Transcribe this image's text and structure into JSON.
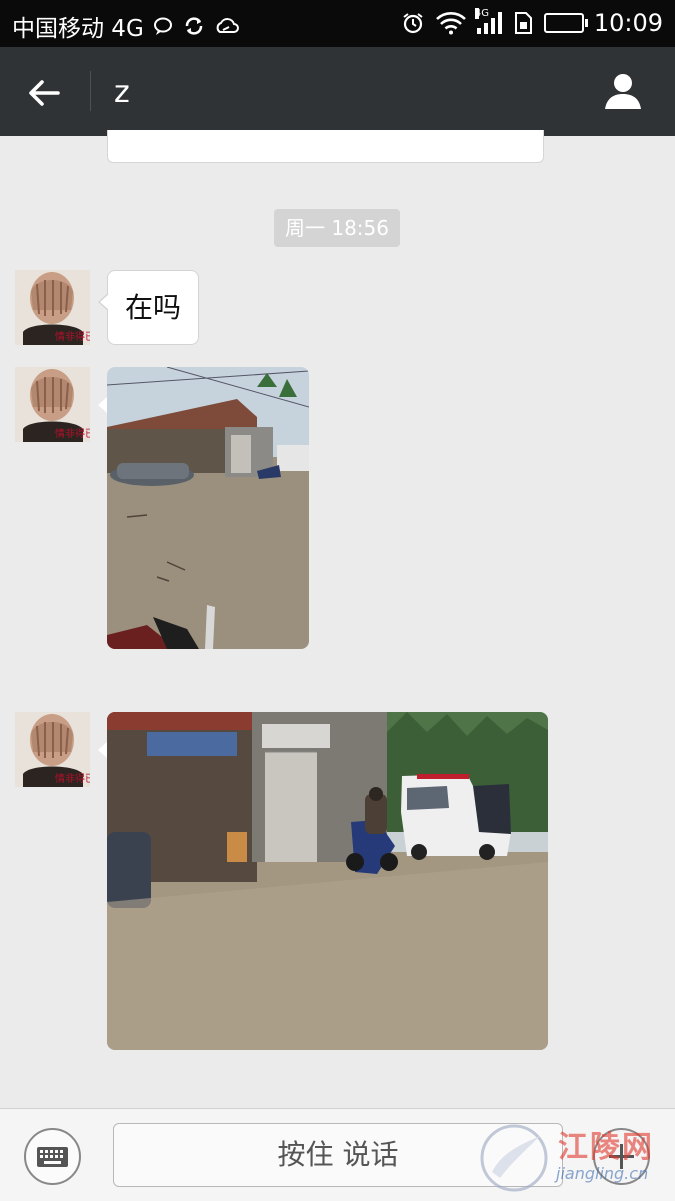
{
  "status_bar": {
    "carrier": "中国移动 4G",
    "network_badge": "4G",
    "time": "10:09",
    "icons": [
      "chat-bubble-icon",
      "sync-icon",
      "cloud-icon",
      "alarm-icon",
      "wifi-icon",
      "signal-icon",
      "sim-icon",
      "battery-icon"
    ]
  },
  "header": {
    "title": "z",
    "back_icon": "arrow-left-icon",
    "profile_icon": "person-icon"
  },
  "messages": {
    "timestamp": "周一 18:56",
    "text_message": "在吗",
    "avatar_caption": "情非得已",
    "images": [
      "street-photo-1",
      "street-photo-2"
    ]
  },
  "input_bar": {
    "hold_to_talk_label": "按住 说话",
    "keyboard_icon": "keyboard-icon",
    "plus_icon": "plus-icon"
  },
  "watermark": {
    "name": "江陵网",
    "url": "jiangling.cn"
  },
  "colors": {
    "status_bar_bg": "#0a0a0a",
    "title_bar_bg": "#2f3335",
    "chat_bg": "#ebebeb",
    "timestamp_bg": "#d4d4d4",
    "bubble_bg": "#ffffff"
  }
}
